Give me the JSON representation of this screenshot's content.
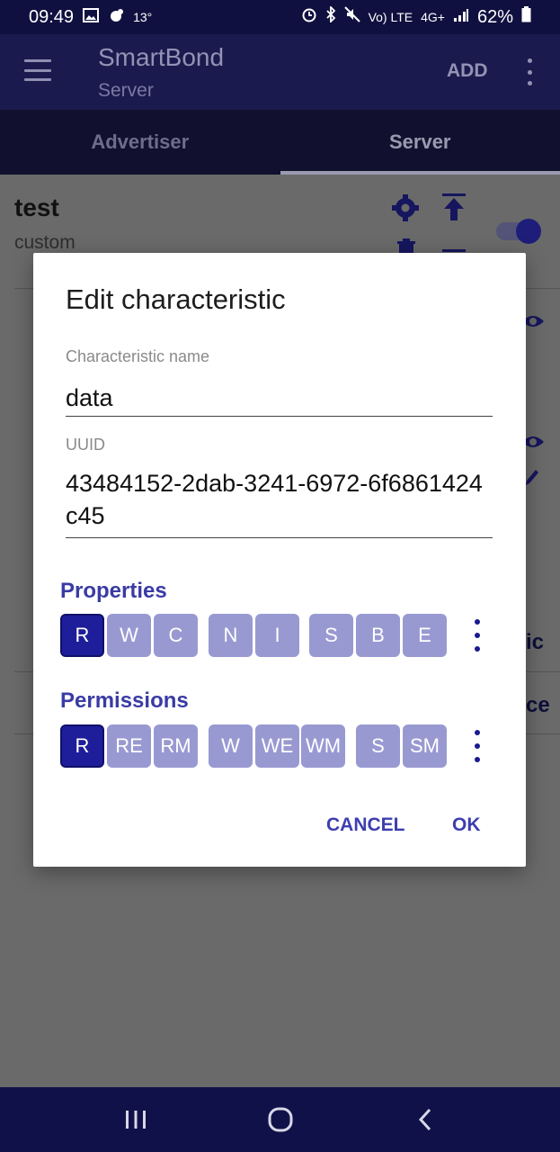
{
  "status_bar": {
    "time": "09:49",
    "temperature": "13°",
    "network_volte": "Vo) LTE",
    "network_4g": "4G+",
    "battery_percent": "62%"
  },
  "app_bar": {
    "title": "SmartBond",
    "subtitle": "Server",
    "add_label": "ADD",
    "menu_icon": "hamburger-menu-icon",
    "overflow_icon": "vertical-dots-icon"
  },
  "tabs": [
    {
      "label": "Advertiser",
      "active": false
    },
    {
      "label": "Server",
      "active": true
    }
  ],
  "background": {
    "service_name": "test",
    "service_type": "custom",
    "partial_texts": [
      "ic",
      "ce"
    ]
  },
  "dialog": {
    "title": "Edit characteristic",
    "name_label": "Characteristic name",
    "name_value": "data",
    "uuid_label": "UUID",
    "uuid_value": "43484152-2dab-3241-6972-6f6861424c45",
    "properties_title": "Properties",
    "properties": [
      {
        "label": "R",
        "selected": true
      },
      {
        "label": "W",
        "selected": false
      },
      {
        "label": "C",
        "selected": false
      },
      {
        "label": "N",
        "selected": false
      },
      {
        "label": "I",
        "selected": false
      },
      {
        "label": "S",
        "selected": false
      },
      {
        "label": "B",
        "selected": false
      },
      {
        "label": "E",
        "selected": false
      }
    ],
    "permissions_title": "Permissions",
    "permissions": [
      {
        "label": "R",
        "selected": true
      },
      {
        "label": "RE",
        "selected": false
      },
      {
        "label": "RM",
        "selected": false
      },
      {
        "label": "W",
        "selected": false
      },
      {
        "label": "WE",
        "selected": false
      },
      {
        "label": "WM",
        "selected": false
      },
      {
        "label": "S",
        "selected": false
      },
      {
        "label": "SM",
        "selected": false
      }
    ],
    "cancel_label": "CANCEL",
    "ok_label": "OK"
  },
  "colors": {
    "accent": "#3a3ba4",
    "chip_selected": "#1e1e9b",
    "chip_unselected": "#9999d2"
  }
}
